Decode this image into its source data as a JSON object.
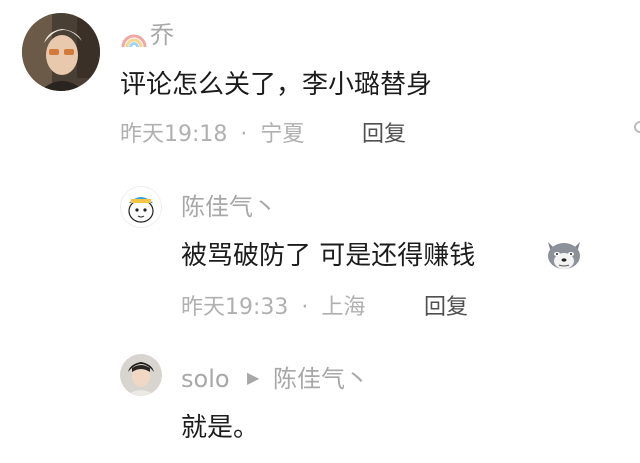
{
  "comments": [
    {
      "username": "乔",
      "text": "评论怎么关了，李小璐替身",
      "time": "昨天19:18",
      "location": "宁夏",
      "reply_label": "回复",
      "name_icon": "rainbow-icon"
    },
    {
      "username": "陈佳气丶",
      "text": "被骂破防了 可是还得赚钱",
      "time": "昨天19:33",
      "location": "上海",
      "reply_label": "回复",
      "emoji": "doge-wolf-emoji"
    },
    {
      "username": "solo",
      "reply_to": "陈佳气丶",
      "text": "就是。"
    }
  ],
  "separator": "·"
}
